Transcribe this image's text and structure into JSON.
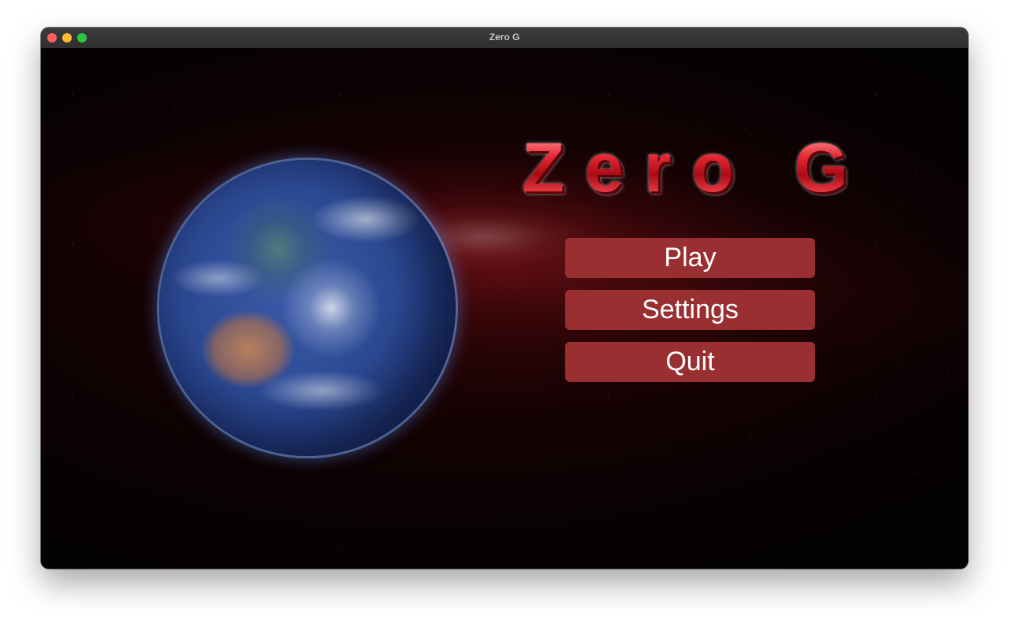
{
  "window": {
    "title": "Zero G",
    "controls": {
      "close_color": "#ff5f57",
      "minimize_color": "#febc2e",
      "zoom_color": "#28c840"
    }
  },
  "game": {
    "title": "Zero G",
    "title_color": "#d01a22",
    "planet": "earth",
    "menu": {
      "play_label": "Play",
      "settings_label": "Settings",
      "quit_label": "Quit",
      "button_color": "#9a2f32"
    }
  }
}
